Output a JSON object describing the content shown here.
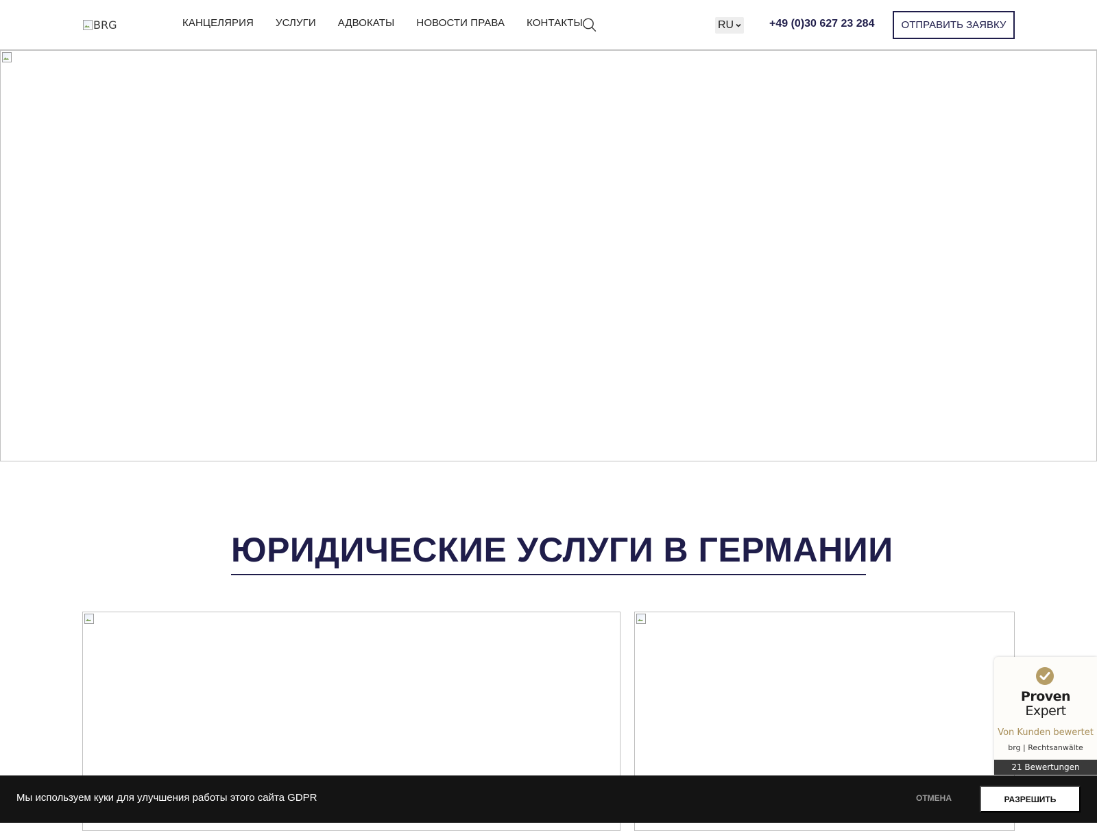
{
  "header": {
    "logo_alt": "BRG",
    "nav": [
      {
        "label": "КАНЦЕЛЯРИЯ"
      },
      {
        "label": "УСЛУГИ"
      },
      {
        "label": "АДВОКАТЫ"
      },
      {
        "label": "НОВОСТИ ПРАВА"
      },
      {
        "label": "КОНТАКТЫ"
      }
    ],
    "search_icon": "search-icon",
    "language": {
      "selected": "RU",
      "icon": "chevron-down-icon"
    },
    "phone": "+49 (0)30 627 23 284",
    "cta_label": "ОТПРАВИТЬ ЗАЯВКУ"
  },
  "hero": {
    "icon": "broken-image-icon"
  },
  "services": {
    "title": "ЮРИДИЧЕСКИЕ УСЛУГИ В ГЕРМАНИИ",
    "cards": [
      {
        "icon": "broken-image-icon"
      },
      {
        "icon": "broken-image-icon"
      }
    ]
  },
  "proven_expert": {
    "brand_line1": "Proven",
    "brand_line2": "Expert",
    "tagline": "Von Kunden bewertet",
    "company": "brg | Rechtsanwälte",
    "reviews": "21 Bewertungen",
    "accent_color": "#b59d66"
  },
  "cookie_bar": {
    "text": "Мы используем куки для улучшения работы этого сайта GDPR",
    "cancel_label": "ОТМЕНА",
    "allow_label": "РАЗРЕШИТЬ"
  },
  "colors": {
    "brand_navy": "#1f1d4a",
    "cookie_bg": "#141414",
    "pe_gold": "#a88f5a"
  }
}
